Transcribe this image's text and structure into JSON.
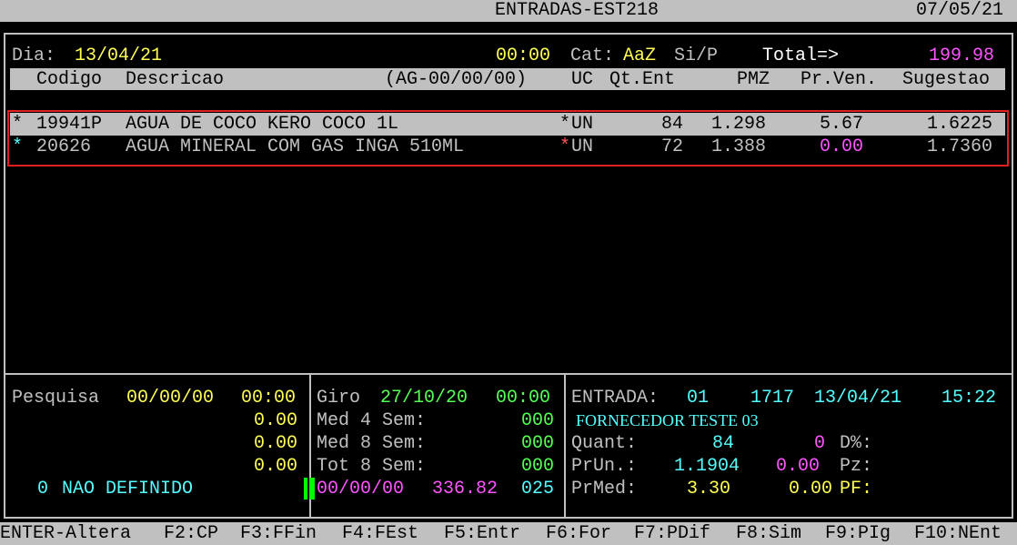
{
  "title_bar": {
    "title": "ENTRADAS-EST218",
    "date": "07/05/21"
  },
  "header": {
    "dia_label": "Dia:",
    "dia_value": "13/04/21",
    "time": "00:00",
    "cat_label": "Cat:",
    "cat_value": "AaZ",
    "sip": "Si/P",
    "total_label": "Total=>",
    "total_value": "199.98"
  },
  "columns": {
    "codigo": "Codigo",
    "descricao": "Descricao",
    "ag": "(AG-00/00/00)",
    "uc": "UC",
    "qt_ent": "Qt.Ent",
    "pmz": "PMZ",
    "pr_ven": "Pr.Ven.",
    "sugestao": "Sugestao"
  },
  "rows": [
    {
      "mark": "*",
      "codigo": "19941P",
      "descricao": "AGUA DE COCO KERO COCO 1L",
      "uc_mark": "*",
      "uc": "UN",
      "qt_ent": "84",
      "pmz": "1.298",
      "pr_ven": "5.67",
      "sugestao": "1.6225"
    },
    {
      "mark": "*",
      "codigo": "20626",
      "descricao": "AGUA MINERAL COM GAS INGA 510ML",
      "uc_mark": "*",
      "uc": "UN",
      "qt_ent": "72",
      "pmz": "1.388",
      "pr_ven": "0.00",
      "sugestao": "1.7360"
    }
  ],
  "panel_left": {
    "pesquisa_label": "Pesquisa",
    "pesquisa_date": "00/00/00",
    "pesquisa_time": "00:00",
    "val1": "0.00",
    "val2": "0.00",
    "val3": "0.00",
    "nd_count": "0",
    "nd_text": "NAO DEFINIDO"
  },
  "panel_mid": {
    "giro_label": "Giro",
    "giro_date": "27/10/20",
    "giro_time": "00:00",
    "med4_label": "Med 4 Sem:",
    "med4_value": "000",
    "med8_label": "Med 8 Sem:",
    "med8_value": "000",
    "tot8_label": "Tot 8 Sem:",
    "tot8_value": "000",
    "last_date": "00/00/00",
    "last_amount": "336.82",
    "last_code": "025"
  },
  "panel_right": {
    "entrada_label": "ENTRADA:",
    "entrada_num": "01",
    "entrada_code": "1717",
    "entrada_date": "13/04/21",
    "entrada_time": "15:22",
    "fornecedor": "FORNECEDOR TESTE 03",
    "quant_label": "Quant:",
    "quant_value": "84",
    "quant_extra": "0",
    "d_label": "D%:",
    "prun_label": "PrUn.:",
    "prun_value": "1.1904",
    "prun_extra": "0.00",
    "pz_label": "Pz:",
    "prmed_label": "PrMed:",
    "prmed_value": "3.30",
    "prmed_extra": "0.00",
    "pf_label": "PF:"
  },
  "function_keys": [
    "ENTER-Altera",
    "F2:CP",
    "F3:FFin",
    "F4:FEst",
    "F5:Entr",
    "F6:For",
    "F7:PDif",
    "F8:Sim",
    "F9:PIg",
    "F10:NEnt"
  ]
}
